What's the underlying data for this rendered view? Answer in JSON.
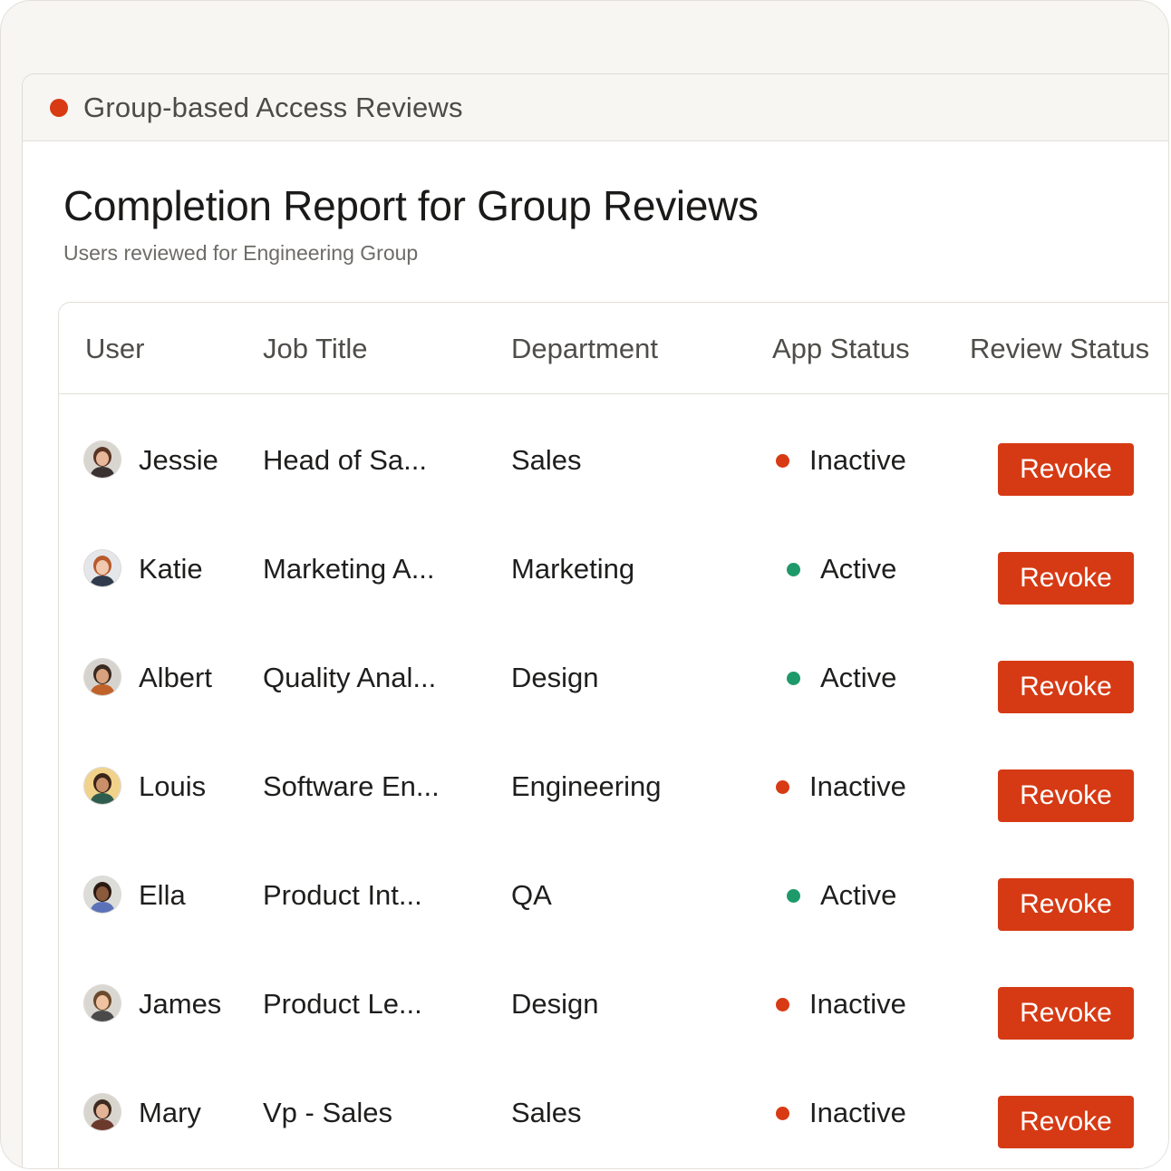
{
  "window": {
    "title": "Group-based Access Reviews"
  },
  "page": {
    "title": "Completion Report for Group Reviews",
    "subtitle": "Users reviewed for Engineering Group"
  },
  "colors": {
    "accent": "#d63a14",
    "inactive": "#d83a14",
    "active": "#1e9a6a"
  },
  "table": {
    "columns": [
      "User",
      "Job Title",
      "Department",
      "App Status",
      "Review Status"
    ],
    "rows": [
      {
        "user": "Jessie",
        "job_title": "Head of Sa...",
        "department": "Sales",
        "app_status": "Inactive",
        "action": "Revoke",
        "avatar": "avatar-jessie"
      },
      {
        "user": "Katie",
        "job_title": "Marketing A...",
        "department": "Marketing",
        "app_status": "Active",
        "action": "Revoke",
        "avatar": "avatar-katie"
      },
      {
        "user": "Albert",
        "job_title": "Quality Anal...",
        "department": "Design",
        "app_status": "Active",
        "action": "Revoke",
        "avatar": "avatar-albert"
      },
      {
        "user": "Louis",
        "job_title": "Software En...",
        "department": "Engineering",
        "app_status": "Inactive",
        "action": "Revoke",
        "avatar": "avatar-louis"
      },
      {
        "user": "Ella",
        "job_title": "Product Int...",
        "department": "QA",
        "app_status": "Active",
        "action": "Revoke",
        "avatar": "avatar-ella"
      },
      {
        "user": "James",
        "job_title": "Product Le...",
        "department": "Design",
        "app_status": "Inactive",
        "action": "Revoke",
        "avatar": "avatar-james"
      },
      {
        "user": "Mary",
        "job_title": "Vp - Sales",
        "department": "Sales",
        "app_status": "Inactive",
        "action": "Revoke",
        "avatar": "avatar-mary"
      }
    ]
  }
}
